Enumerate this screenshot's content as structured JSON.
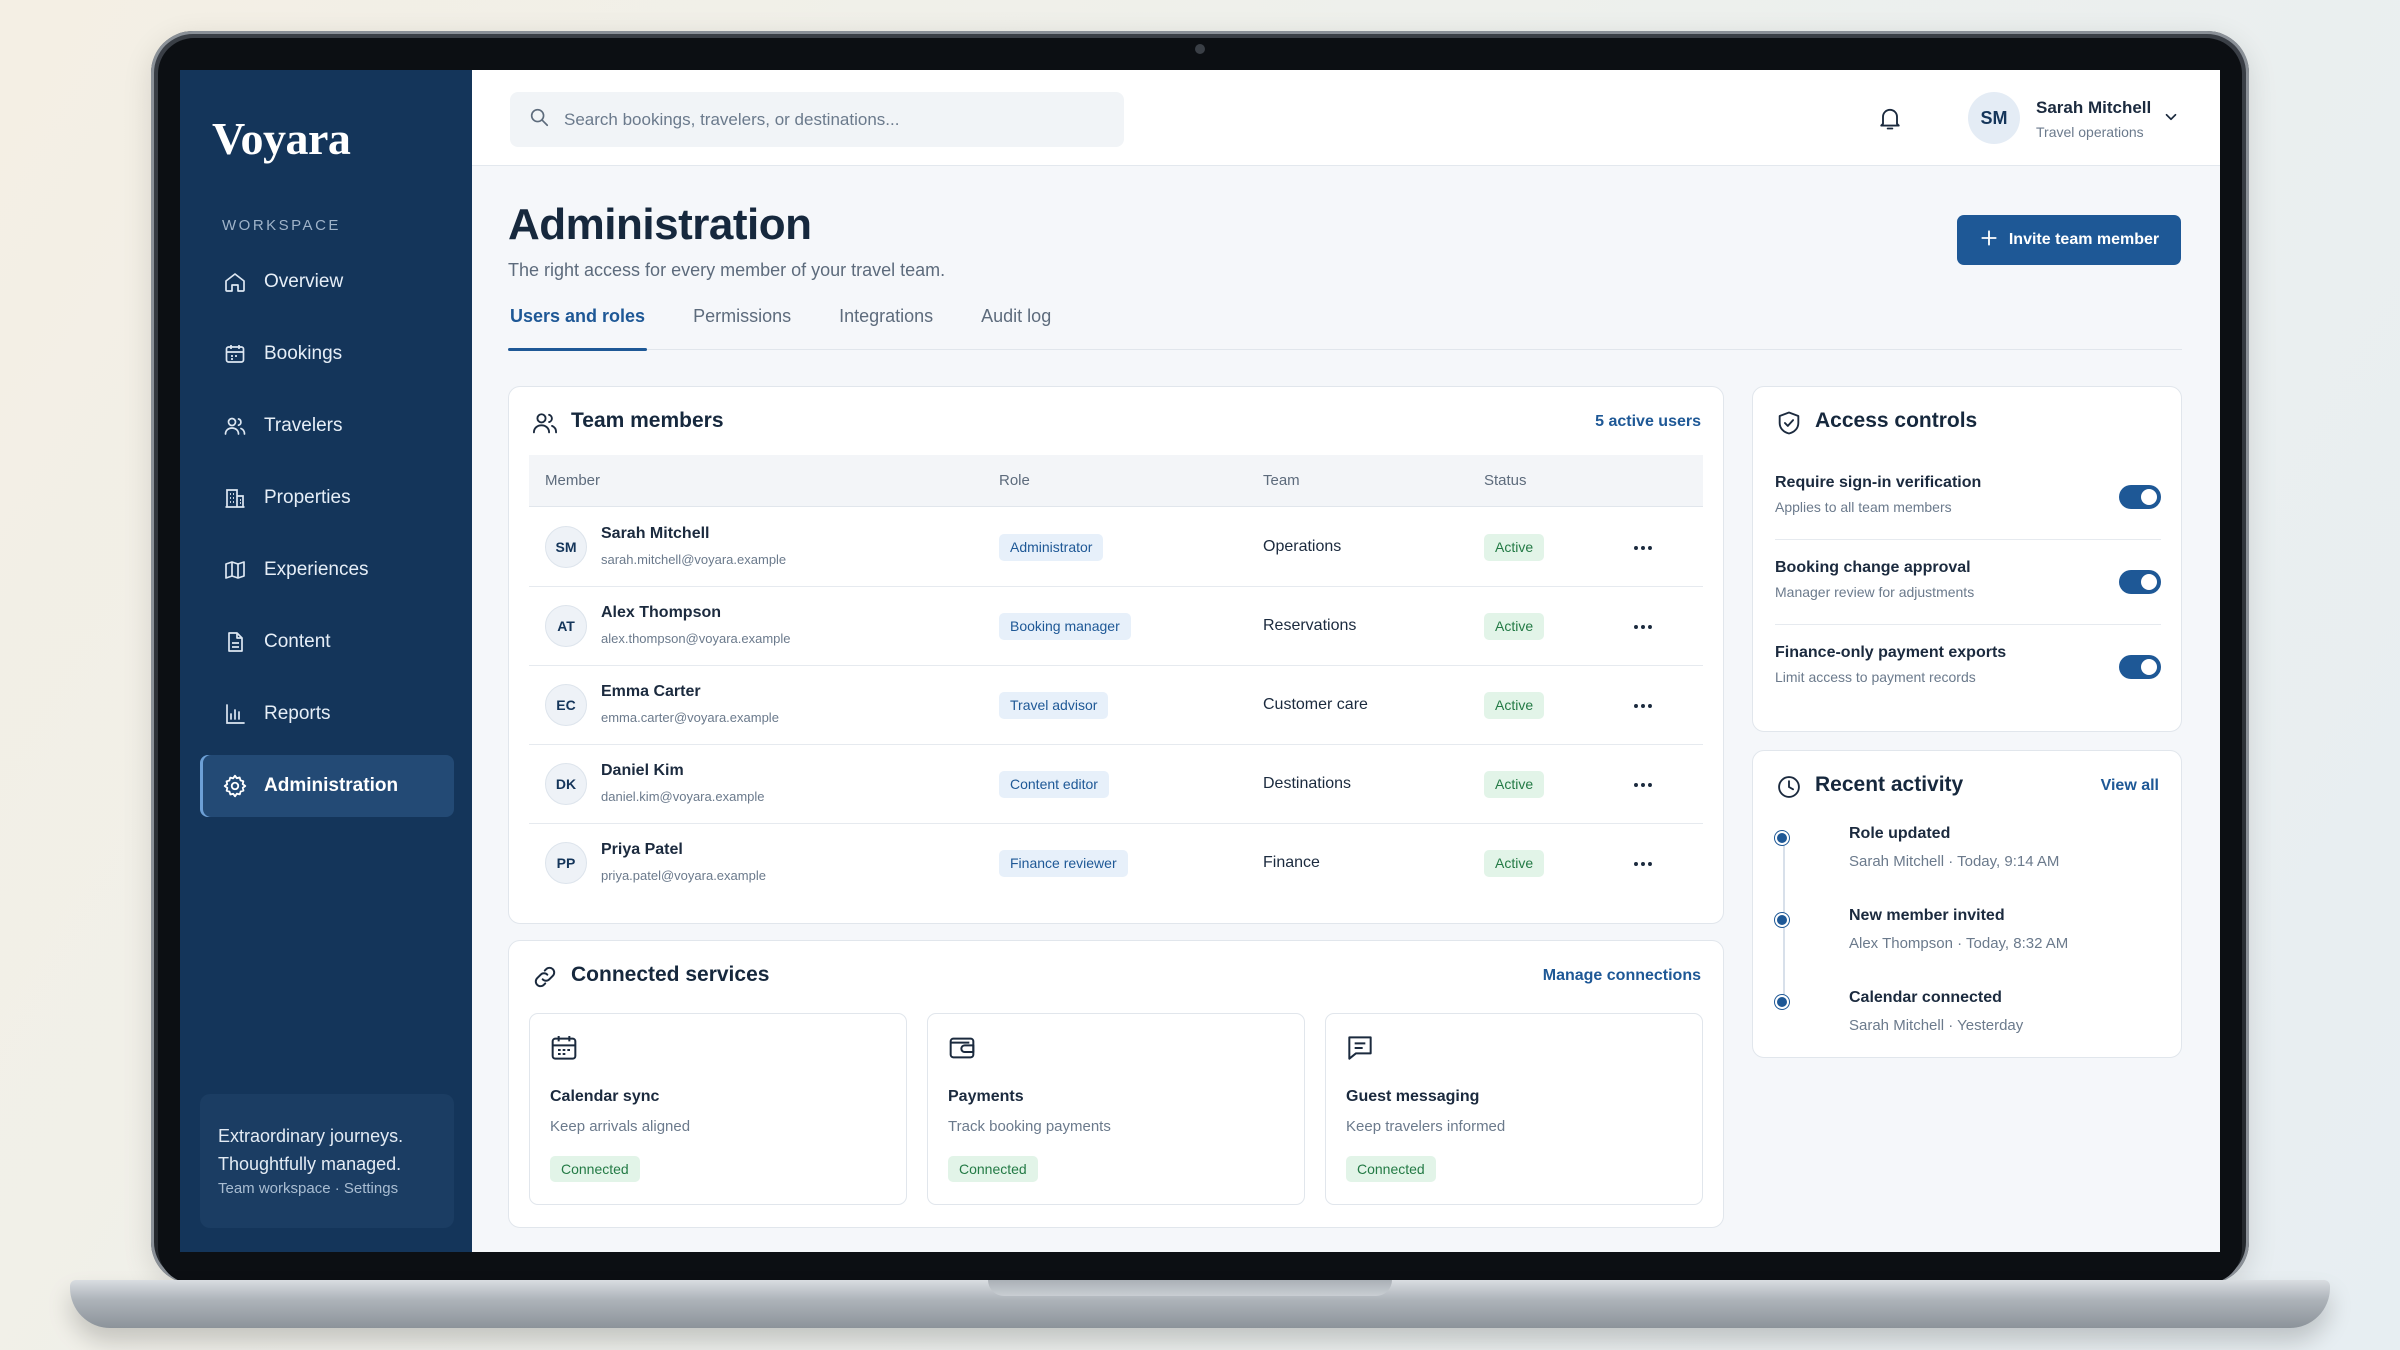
{
  "app": {
    "logo": "Voyara"
  },
  "sidebar": {
    "section_label": "WORKSPACE",
    "items": [
      {
        "label": "Overview",
        "icon": "home-icon"
      },
      {
        "label": "Bookings",
        "icon": "calendar-icon"
      },
      {
        "label": "Travelers",
        "icon": "users-icon"
      },
      {
        "label": "Properties",
        "icon": "building-icon"
      },
      {
        "label": "Experiences",
        "icon": "map-icon"
      },
      {
        "label": "Content",
        "icon": "document-icon"
      },
      {
        "label": "Reports",
        "icon": "bar-chart-icon"
      },
      {
        "label": "Administration",
        "icon": "gear-icon",
        "active": true
      }
    ],
    "footer": {
      "line1": "Extraordinary journeys.",
      "line2": "Thoughtfully managed.",
      "line3": "Team workspace · Settings"
    }
  },
  "topbar": {
    "search_placeholder": "Search bookings, travelers, or destinations...",
    "user": {
      "initials": "SM",
      "name": "Sarah Mitchell",
      "role": "Travel operations"
    }
  },
  "page": {
    "title": "Administration",
    "subtitle": "The right access for every member of your travel team.",
    "invite_label": "Invite team member",
    "tabs": [
      {
        "label": "Users and roles",
        "active": true
      },
      {
        "label": "Permissions"
      },
      {
        "label": "Integrations"
      },
      {
        "label": "Audit log"
      }
    ]
  },
  "team": {
    "title": "Team members",
    "count_label": "5 active users",
    "columns": [
      "Member",
      "Role",
      "Team",
      "Status"
    ],
    "rows": [
      {
        "initials": "SM",
        "name": "Sarah Mitchell",
        "email": "sarah.mitchell@voyara.example",
        "role": "Administrator",
        "team": "Operations",
        "status": "Active"
      },
      {
        "initials": "AT",
        "name": "Alex Thompson",
        "email": "alex.thompson@voyara.example",
        "role": "Booking manager",
        "team": "Reservations",
        "status": "Active"
      },
      {
        "initials": "EC",
        "name": "Emma Carter",
        "email": "emma.carter@voyara.example",
        "role": "Travel advisor",
        "team": "Customer care",
        "status": "Active"
      },
      {
        "initials": "DK",
        "name": "Daniel Kim",
        "email": "daniel.kim@voyara.example",
        "role": "Content editor",
        "team": "Destinations",
        "status": "Active"
      },
      {
        "initials": "PP",
        "name": "Priya Patel",
        "email": "priya.patel@voyara.example",
        "role": "Finance reviewer",
        "team": "Finance",
        "status": "Active"
      }
    ]
  },
  "services": {
    "title": "Connected services",
    "link": "Manage connections",
    "items": [
      {
        "name": "Calendar sync",
        "desc": "Keep arrivals aligned",
        "status": "Connected",
        "icon": "calendar-icon"
      },
      {
        "name": "Payments",
        "desc": "Track booking payments",
        "status": "Connected",
        "icon": "wallet-icon"
      },
      {
        "name": "Guest messaging",
        "desc": "Keep travelers informed",
        "status": "Connected",
        "icon": "message-icon"
      }
    ]
  },
  "access": {
    "title": "Access controls",
    "items": [
      {
        "title": "Require sign-in verification",
        "desc": "Applies to all team members",
        "enabled": true
      },
      {
        "title": "Booking change approval",
        "desc": "Manager review for adjustments",
        "enabled": true
      },
      {
        "title": "Finance-only payment exports",
        "desc": "Limit access to payment records",
        "enabled": true
      }
    ]
  },
  "activity": {
    "title": "Recent activity",
    "link": "View all",
    "items": [
      {
        "title": "Role updated",
        "meta": "Sarah Mitchell · Today, 9:14 AM"
      },
      {
        "title": "New member invited",
        "meta": "Alex Thompson · Today, 8:32 AM"
      },
      {
        "title": "Calendar connected",
        "meta": "Sarah Mitchell · Yesterday"
      }
    ]
  },
  "colors": {
    "sidebar": "#14355a",
    "accent": "#1e5896",
    "success_bg": "#e2f4e8",
    "success_text": "#237a45"
  }
}
